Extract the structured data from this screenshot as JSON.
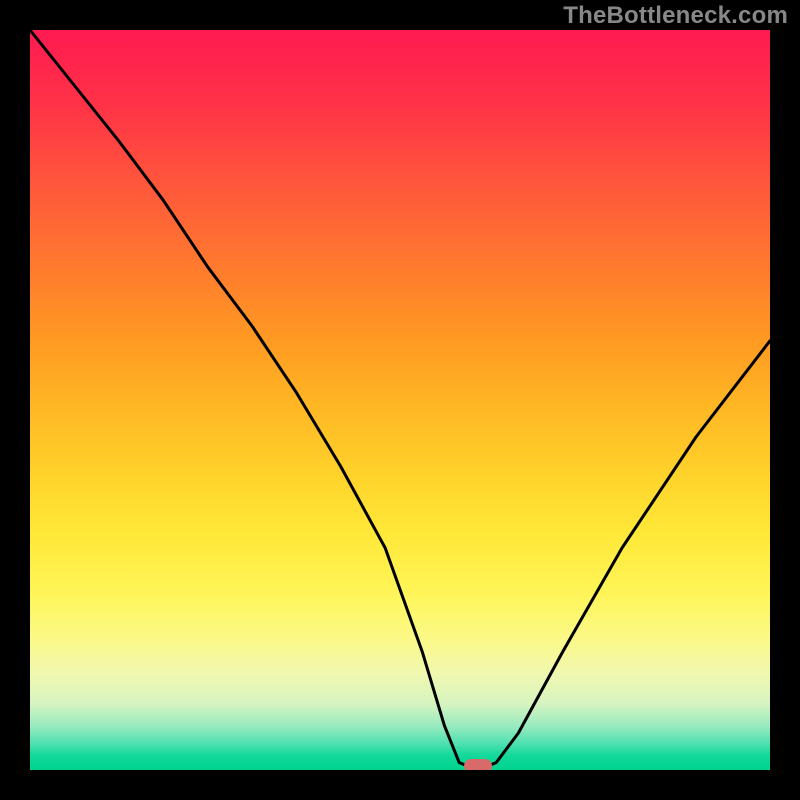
{
  "watermark": "TheBottleneck.com",
  "chart_data": {
    "type": "line",
    "title": "",
    "xlabel": "",
    "ylabel": "",
    "xlim": [
      0,
      100
    ],
    "ylim": [
      0,
      100
    ],
    "x": [
      0,
      6,
      12,
      18,
      24,
      30,
      36,
      42,
      48,
      53,
      56,
      58,
      60.5,
      63,
      66,
      72,
      80,
      90,
      100
    ],
    "values": [
      100,
      92.5,
      85,
      77,
      68,
      60,
      51,
      41,
      30,
      16,
      6,
      1,
      0,
      1,
      5,
      16,
      30,
      45,
      58
    ],
    "marker": {
      "x": 60.5,
      "y": 0
    },
    "gradient_stops": [
      {
        "pos": 0,
        "color": "#ff1a51"
      },
      {
        "pos": 0.1,
        "color": "#ff3247"
      },
      {
        "pos": 0.22,
        "color": "#ff5a3a"
      },
      {
        "pos": 0.32,
        "color": "#ff7a2e"
      },
      {
        "pos": 0.42,
        "color": "#ff9a22"
      },
      {
        "pos": 0.5,
        "color": "#ffb424"
      },
      {
        "pos": 0.6,
        "color": "#ffd22a"
      },
      {
        "pos": 0.68,
        "color": "#ffe838"
      },
      {
        "pos": 0.76,
        "color": "#fff558"
      },
      {
        "pos": 0.82,
        "color": "#fbf985"
      },
      {
        "pos": 0.87,
        "color": "#f1f8b0"
      },
      {
        "pos": 0.91,
        "color": "#d6f4c0"
      },
      {
        "pos": 0.94,
        "color": "#9aebc0"
      },
      {
        "pos": 0.965,
        "color": "#4de0b0"
      },
      {
        "pos": 0.98,
        "color": "#13d99a"
      },
      {
        "pos": 1.0,
        "color": "#00d38f"
      }
    ]
  }
}
